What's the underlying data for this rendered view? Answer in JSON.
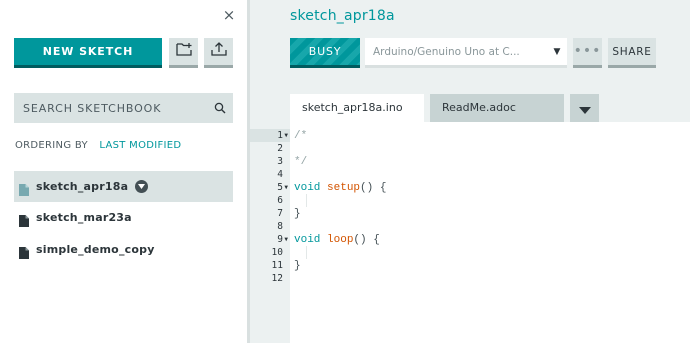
{
  "sidebar": {
    "close_glyph": "×",
    "new_sketch_label": "NEW SKETCH",
    "search_label": "SEARCH SKETCHBOOK",
    "ordering_label": "ORDERING BY",
    "ordering_value": "LAST MODIFIED",
    "sketches": [
      {
        "name": "sketch_apr18a",
        "active": true
      },
      {
        "name": "sketch_mar23a",
        "active": false
      },
      {
        "name": "simple_demo_copy",
        "active": false
      }
    ]
  },
  "header": {
    "sketch_title": "sketch_apr18a",
    "busy_label": "BUSY",
    "board_value": "Arduino/Genuino Uno at C...",
    "more_label": "•••",
    "share_label": "SHARE"
  },
  "tabs": [
    {
      "label": "sketch_apr18a.ino",
      "active": true
    },
    {
      "label": "ReadMe.adoc",
      "active": false
    }
  ],
  "editor": {
    "line_numbers": [
      "1",
      "2",
      "3",
      "4",
      "5",
      "6",
      "7",
      "8",
      "9",
      "10",
      "11",
      "12"
    ],
    "lines": [
      "/*",
      "",
      "*/",
      "",
      "void setup() {",
      "",
      "}",
      "",
      "void loop() {",
      "",
      "}",
      ""
    ]
  },
  "colors": {
    "accent": "#00979c",
    "sidebar_bg": "#ffffff",
    "panel_bg": "#ecf1f1"
  },
  "icons": [
    "close-icon",
    "new-folder-icon",
    "upload-icon",
    "search-icon",
    "file-icon",
    "chevron-down-icon",
    "caret-down-icon",
    "fold-arrow-icon"
  ]
}
